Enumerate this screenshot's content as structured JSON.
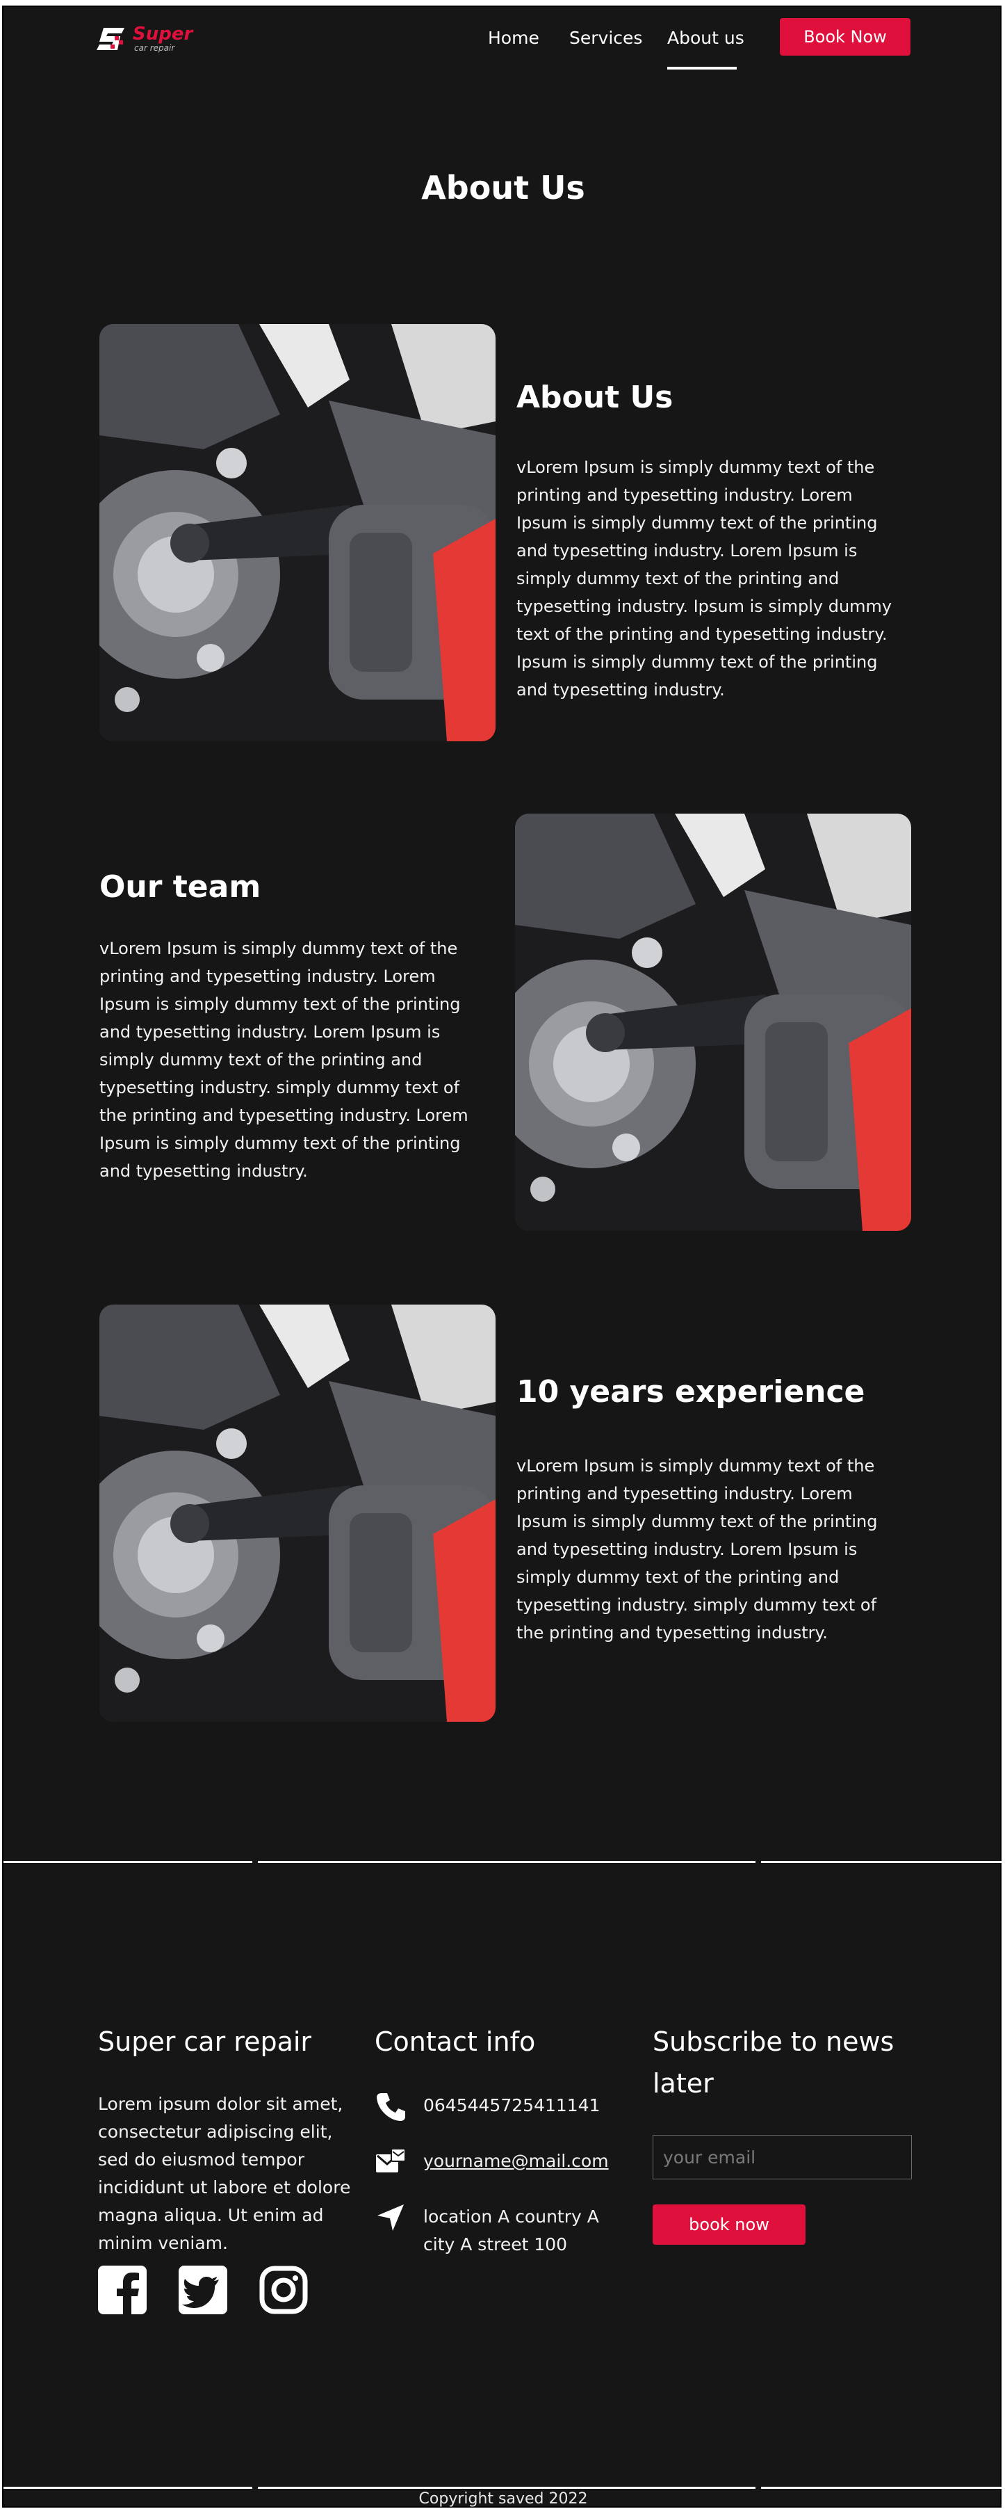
{
  "brand": {
    "name": "Super",
    "tagline": "car repair",
    "accent_color": "#e0103c"
  },
  "nav": {
    "links": [
      {
        "label": "Home"
      },
      {
        "label": "Services"
      },
      {
        "label": "About us",
        "active": true
      }
    ],
    "cta": "Book Now"
  },
  "page": {
    "title": "About Us"
  },
  "sections": [
    {
      "title": "About Us",
      "body": "vLorem Ipsum is simply dummy text of the printing and typesetting industry. Lorem Ipsum is simply dummy text of the printing and typesetting industry. Lorem Ipsum is simply dummy text of the printing and typesetting industry. Ipsum is simply dummy text of the printing and typesetting industry. Ipsum is simply dummy text of the printing and typesetting industry.",
      "image_icon": "impact-wrench-wheel-photo"
    },
    {
      "title": "Our team",
      "body": "vLorem Ipsum is simply dummy text of the printing and typesetting industry. Lorem Ipsum is simply dummy text of the printing and typesetting industry. Lorem Ipsum is simply dummy text of the printing and typesetting industry. simply dummy text of the printing and typesetting industry. Lorem Ipsum is simply dummy text of the printing and typesetting industry.",
      "image_icon": "impact-wrench-wheel-photo"
    },
    {
      "title": "10 years experience",
      "body": "vLorem Ipsum is simply dummy text of the printing and typesetting industry. Lorem Ipsum is simply dummy text of the printing and typesetting industry. Lorem Ipsum is simply dummy text of the printing and typesetting industry. simply dummy text of the printing and typesetting industry.",
      "image_icon": "impact-wrench-wheel-photo"
    }
  ],
  "footer": {
    "about": {
      "title": "Super car  repair",
      "text": "Lorem ipsum dolor sit amet, consectetur adipiscing elit, sed do eiusmod tempor incididunt ut labore et dolore magna aliqua. Ut enim ad minim veniam."
    },
    "social": [
      "facebook-icon",
      "twitter-icon",
      "instagram-icon"
    ],
    "contact": {
      "title": "Contact info",
      "phone": "0645445725411141",
      "email": "yourname@mail.com",
      "location": "location A country A city A street 100"
    },
    "subscribe": {
      "title": "Subscribe to news later",
      "placeholder": "your email",
      "button": "book now"
    },
    "copyright": "Copyright saved 2022"
  }
}
